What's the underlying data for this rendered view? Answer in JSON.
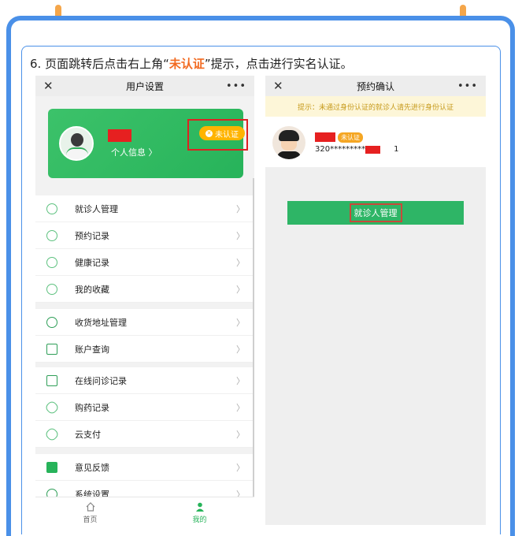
{
  "instruction": {
    "prefix": "6. 页面跳转后点击右上角“",
    "highlight": "未认证",
    "suffix": "”提示，点击进行实名认证。"
  },
  "left_screen": {
    "title": "用户设置",
    "close_glyph": "✕",
    "more_glyph": "•••",
    "profile": {
      "info_label": "个人信息 〉",
      "unverified_label": "未认证"
    },
    "menu_groups": [
      [
        "就诊人管理",
        "预约记录",
        "健康记录",
        "我的收藏"
      ],
      [
        "收货地址管理",
        "账户查询"
      ],
      [
        "在线问诊记录",
        "购药记录",
        "云支付"
      ],
      [
        "意见反馈",
        "系统设置"
      ]
    ],
    "chevron": "〉",
    "tabs": [
      {
        "label": "首页",
        "icon": "home-icon"
      },
      {
        "label": "我的",
        "icon": "person-icon"
      }
    ]
  },
  "right_screen": {
    "title": "预约确认",
    "close_glyph": "✕",
    "more_glyph": "•••",
    "tip": "提示：未通过身份认证的就诊人请先进行身份认证",
    "patient": {
      "badge": "未认证",
      "id_masked": "320************",
      "id_tail": "1"
    },
    "manage_button": "就诊人管理"
  },
  "colors": {
    "accent_green": "#27b35a",
    "highlight_orange": "#f26b22",
    "frame_blue": "#4a90e8",
    "warning_yellow": "#ffb400"
  }
}
